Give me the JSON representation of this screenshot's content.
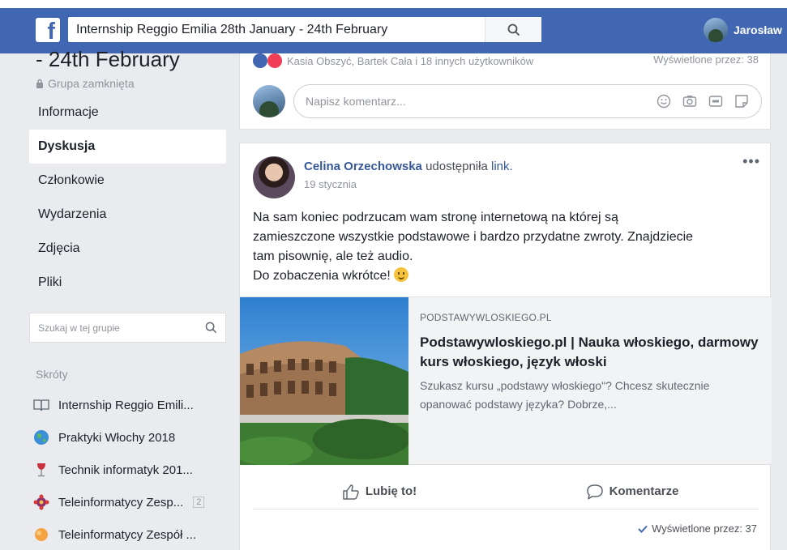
{
  "topbar": {
    "logo": "f",
    "search_value": "Internship Reggio Emilia 28th January - 24th February",
    "user_name": "Jarosław"
  },
  "group": {
    "title_fragment": "- 24th February",
    "type": "Grupa zamknięta"
  },
  "nav": {
    "items": [
      {
        "label": "Informacje"
      },
      {
        "label": "Dyskusja",
        "active": true
      },
      {
        "label": "Członkowie"
      },
      {
        "label": "Wydarzenia"
      },
      {
        "label": "Zdjęcia"
      },
      {
        "label": "Pliki"
      }
    ]
  },
  "group_search": {
    "placeholder": "Szukaj w tej grupie"
  },
  "shortcuts": {
    "title": "Skróty",
    "items": [
      {
        "label": "Internship Reggio Emili...",
        "icon": "book-icon"
      },
      {
        "label": "Praktyki Włochy 2018",
        "icon": "globe-icon"
      },
      {
        "label": "Technik informatyk 201...",
        "icon": "wine-glass-icon"
      },
      {
        "label": "Teleinformatycy Zesp...",
        "icon": "gear-flower-icon",
        "badge": "2"
      },
      {
        "label": "Teleinformatycy Zespół ...",
        "icon": "orange-blob-icon"
      }
    ]
  },
  "previous_post": {
    "reactions_text": "Kasia Obszyć, Bartek Cała i 18 innych użytkowników",
    "seen": "Wyświetlone przez: 38",
    "comment_placeholder": "Napisz komentarz..."
  },
  "post": {
    "author": "Celina Orzechowska",
    "action": "udostępniła",
    "link_word": "link.",
    "date": "19 stycznia",
    "more": "•••",
    "text_lines": [
      "Na sam koniec podrzucam wam stronę internetową na której są",
      "zamieszczone wszystkie podstawowe i bardzo przydatne zwroty. Znajdziecie",
      "tam pisownię, ale też audio.",
      "Do zobaczenia wkrótce!"
    ],
    "preview": {
      "domain": "PODSTAWYWLOSKIEGO.PL",
      "title": "Podstawywloskiego.pl | Nauka włoskiego, darmowy kurs włoskiego, język włoski",
      "description": "Szukasz kursu „podstawy włoskiego\"? Chcesz skutecznie opanować podstawy języka? Dobrze,..."
    },
    "like_label": "Lubię to!",
    "comment_label": "Komentarze",
    "seen": "Wyświetlone przez: 37"
  },
  "colors": {
    "brand_blue": "#4267b2",
    "link_blue": "#365899",
    "page_bg": "#e9ebee"
  }
}
